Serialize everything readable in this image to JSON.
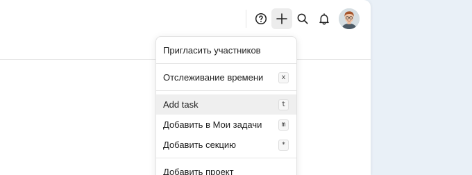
{
  "toolbar": {
    "help_icon": "help-circle-icon",
    "add_icon": "plus-icon",
    "search_icon": "search-icon",
    "notifications_icon": "bell-icon",
    "avatar_icon": "user-avatar"
  },
  "add_menu": {
    "items": [
      {
        "label": "Пригласить участников",
        "shortcut": ""
      },
      {
        "label": "Отслеживание времени",
        "shortcut": "x"
      },
      {
        "label": "Add task",
        "shortcut": "t"
      },
      {
        "label": "Добавить в Мои задачи",
        "shortcut": "m"
      },
      {
        "label": "Добавить секцию",
        "shortcut": "*"
      },
      {
        "label": "Добавить проект",
        "shortcut": ""
      }
    ]
  },
  "colors": {
    "background": "#e9f0f7",
    "panel": "#ffffff",
    "hover": "#efefef"
  }
}
